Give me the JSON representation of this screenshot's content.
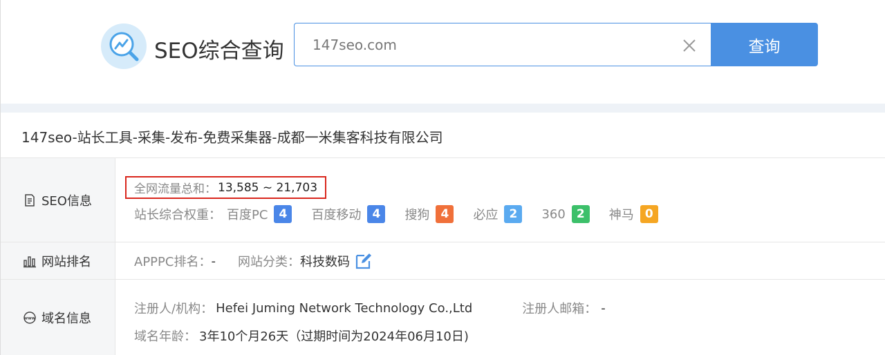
{
  "header": {
    "brand": "SEO综合查询",
    "search_value": "147seo.com",
    "search_button": "查询"
  },
  "site_title": "147seo-站长工具-采集-发布-免费采集器-成都一米集客科技有限公司",
  "seo": {
    "label": "SEO信息",
    "traffic_label": "全网流量总和：",
    "traffic_value": "13,585 ~ 21,703",
    "weights_label": "站长综合权重：",
    "weights": [
      {
        "name": "百度PC",
        "value": "4",
        "color": "#4a86e8"
      },
      {
        "name": "百度移动",
        "value": "4",
        "color": "#4a86e8"
      },
      {
        "name": "搜狗",
        "value": "4",
        "color": "#f0703a"
      },
      {
        "name": "必应",
        "value": "2",
        "color": "#5aaaf0"
      },
      {
        "name": "360",
        "value": "2",
        "color": "#3cc06a"
      },
      {
        "name": "神马",
        "value": "0",
        "color": "#f5a623"
      }
    ]
  },
  "ranking": {
    "label": "网站排名",
    "apppc_label": "APPPC排名：",
    "apppc_value": "-",
    "category_label": "网站分类：",
    "category_value": "科技数码"
  },
  "domain": {
    "label": "域名信息",
    "registrant_label": "注册人/机构：",
    "registrant_value": "Hefei Juming Network Technology Co.,Ltd",
    "email_label": "注册人邮箱：",
    "email_value": "-",
    "age_label": "域名年龄：",
    "age_value": "3年10个月26天（过期时间为2024年06月10日)"
  },
  "colors": {
    "accent": "#4a90e2",
    "highlight_border": "#d9261c"
  }
}
